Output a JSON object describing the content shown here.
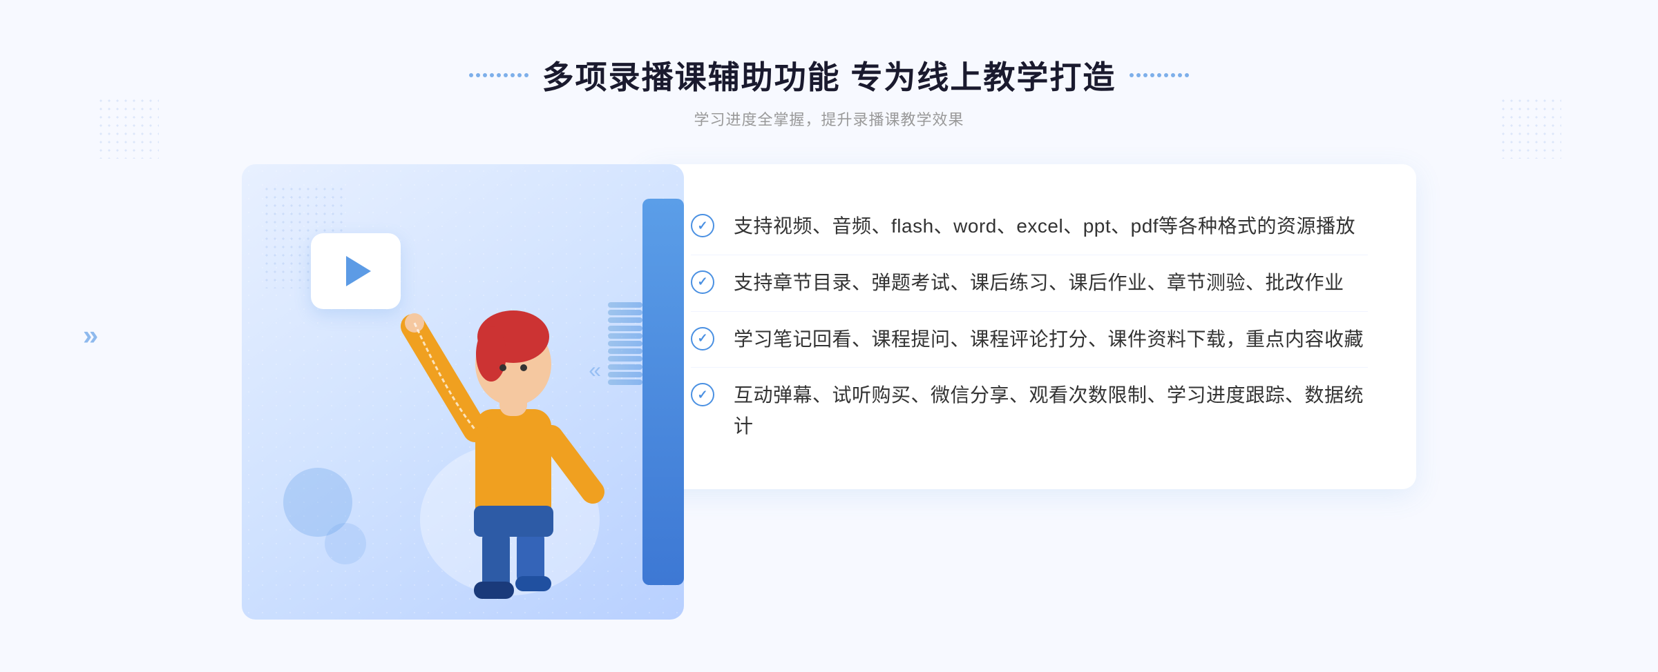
{
  "header": {
    "title": "多项录播课辅助功能 专为线上教学打造",
    "subtitle": "学习进度全掌握，提升录播课教学效果",
    "dot_icon_left": "grid-icon",
    "dot_icon_right": "grid-icon"
  },
  "features": [
    {
      "id": 1,
      "text": "支持视频、音频、flash、word、excel、ppt、pdf等各种格式的资源播放"
    },
    {
      "id": 2,
      "text": "支持章节目录、弹题考试、课后练习、课后作业、章节测验、批改作业"
    },
    {
      "id": 3,
      "text": "学习笔记回看、课程提问、课程评论打分、课件资料下载，重点内容收藏"
    },
    {
      "id": 4,
      "text": "互动弹幕、试听购买、微信分享、观看次数限制、学习进度跟踪、数据统计"
    }
  ],
  "decoration": {
    "chevron_left": "»",
    "play_button": "▶"
  }
}
